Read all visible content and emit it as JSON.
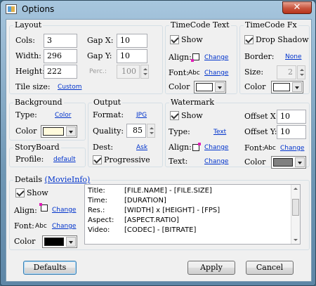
{
  "window": {
    "title": "Options",
    "close_glyph": "✕"
  },
  "layout": {
    "title": "Layout",
    "cols_label": "Cols:",
    "cols_value": "3",
    "width_label": "Width:",
    "width_value": "296",
    "height_label": "Height:",
    "height_value": "222",
    "gapx_label": "Gap X:",
    "gapx_value": "10",
    "gapy_label": "Gap Y:",
    "gapy_value": "10",
    "perc_label": "Perc.:",
    "perc_value": "100",
    "tilesize_label": "Tile size:",
    "tilesize_link": "Custom"
  },
  "timecode_text": {
    "title": "TimeCode Text",
    "show_label": "Show",
    "show_checked": true,
    "align_label": "Align:",
    "align_link": "Change",
    "font_label": "Font:",
    "font_sample": "Abc",
    "font_link": "Change",
    "color_label": "Color",
    "color_value": "#ffffff"
  },
  "timecode_fx": {
    "title": "TimeCode Fx",
    "dropshadow_label": "Drop Shadow",
    "dropshadow_checked": true,
    "border_label": "Border:",
    "border_link": "None",
    "size_label": "Size:",
    "size_value": "2",
    "color_label": "Color",
    "color_value": "#ffffff"
  },
  "background": {
    "title": "Background",
    "type_label": "Type:",
    "type_link": "Color",
    "color_label": "Color",
    "color_value": "#fffadc"
  },
  "output": {
    "title": "Output",
    "format_label": "Format:",
    "format_link": "JPG",
    "quality_label": "Quality:",
    "quality_value": "85",
    "dest_label": "Dest:",
    "dest_link": "Ask",
    "progressive_label": "Progressive",
    "progressive_checked": true
  },
  "watermark": {
    "title": "Watermark",
    "show_label": "Show",
    "show_checked": true,
    "type_label": "Type:",
    "type_link": "Text",
    "align_label": "Align:",
    "align_link": "Change",
    "text_label": "Text:",
    "text_link": "Change",
    "offsetx_label": "Offset X:",
    "offsetx_value": "10",
    "offsety_label": "Offset Y:",
    "offsety_value": "10",
    "font_label": "Font:",
    "font_sample": "Abc",
    "font_link": "Change",
    "color_label": "Color",
    "color_value": "#808080"
  },
  "storyboard": {
    "title": "StoryBoard",
    "profile_label": "Profile:",
    "profile_link": "default"
  },
  "details": {
    "title": "Details",
    "movieinfo_link": "(MovieInfo)",
    "show_label": "Show",
    "show_checked": true,
    "align_label": "Align:",
    "align_link": "Change",
    "font_label": "Font:",
    "font_sample": "Abc",
    "font_link": "Change",
    "color_label": "Color",
    "color_value": "#000000",
    "lines": [
      {
        "key": "Title:",
        "value": "[FILE.NAME] - [FILE.SIZE]"
      },
      {
        "key": "Time:",
        "value": "[DURATION]"
      },
      {
        "key": "Res.:",
        "value": "[WIDTH] x [HEIGHT] - [FPS]"
      },
      {
        "key": "Aspect:",
        "value": "[ASPECT.RATIO]"
      },
      {
        "key": "Video:",
        "value": "[CODEC] - [BITRATE]"
      }
    ]
  },
  "buttons": {
    "defaults": "Defaults",
    "apply": "Apply",
    "cancel": "Cancel"
  }
}
